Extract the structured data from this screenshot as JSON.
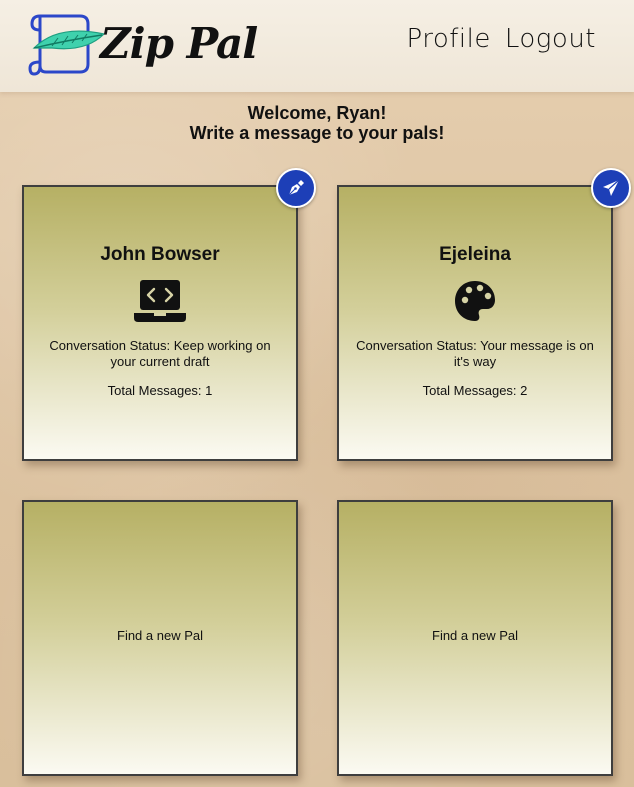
{
  "header": {
    "logo_text": "Zip Pal",
    "nav": {
      "profile_label": "Profile",
      "logout_label": "Logout"
    }
  },
  "welcome": {
    "line1": "Welcome, Ryan!",
    "line2": "Write a message to your pals!"
  },
  "cards": [
    {
      "name": "John Bowser",
      "icon": "laptop-code-icon",
      "status": "Conversation Status: Keep working on your current draft",
      "total": "Total Messages: 1",
      "action_icon": "pen-nib-icon"
    },
    {
      "name": "Ejeleina",
      "icon": "palette-icon",
      "status": "Conversation Status: Your message is on it's way",
      "total": "Total Messages: 2",
      "action_icon": "paper-plane-icon"
    },
    {
      "empty_label": "Find a new Pal"
    },
    {
      "empty_label": "Find a new Pal"
    }
  ],
  "colors": {
    "accent": "#1d3fb7",
    "card_top": "#b6b064",
    "card_bottom": "#fbfaf2",
    "header_bg": "#f3ece1",
    "page_bg": "#dfc6a4"
  }
}
